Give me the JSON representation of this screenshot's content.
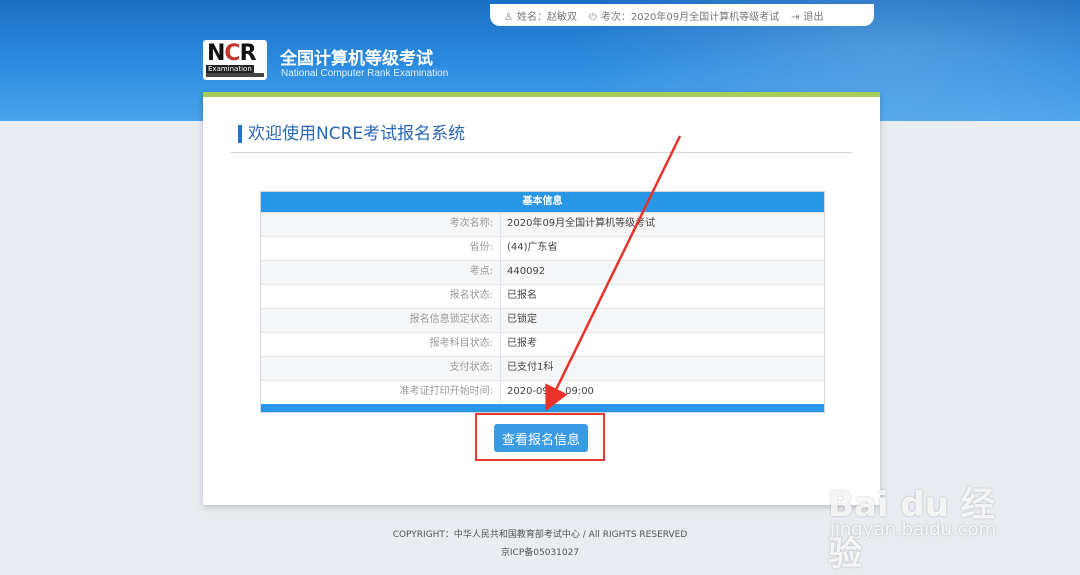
{
  "topbar": {
    "user_label": "姓名：赵敏双",
    "exam_label": "考次：2020年09月全国计算机等级考试",
    "logout_label": "退出"
  },
  "brand": {
    "logo_text_ncr": "NCR",
    "logo_text_exam": "Examination",
    "title": "全国计算机等级考试",
    "subtitle": "National Computer Rank Examination"
  },
  "main": {
    "title": "欢迎使用NCRE考试报名系统",
    "table_header": "基本信息",
    "rows": [
      {
        "label": "考次名称:",
        "value": "2020年09月全国计算机等级考试"
      },
      {
        "label": "省份:",
        "value": "(44)广东省"
      },
      {
        "label": "考点:",
        "value": "440092"
      },
      {
        "label": "报名状态:",
        "value": "已报名"
      },
      {
        "label": "报名信息锁定状态:",
        "value": "已锁定"
      },
      {
        "label": "报考科目状态:",
        "value": "已报考"
      },
      {
        "label": "支付状态:",
        "value": "已支付1科"
      },
      {
        "label": "准考证打印开始时间:",
        "value": "2020-09-... 09:00"
      }
    ],
    "button_label": "查看报名信息"
  },
  "footer": {
    "copyright": "COPYRIGHT：中华人民共和国教育部考试中心 / All RIGHTS RESERVED",
    "icp": "京ICP备05031027"
  },
  "watermark": {
    "main": "Bai du 经验",
    "sub": "jingyan.baidu.com"
  },
  "colors": {
    "header_blue": "#2d8de0",
    "accent_green": "#a6cf5a",
    "table_blue": "#2a97e6",
    "button_blue": "#3a9be4",
    "highlight_red": "#e33b2e"
  }
}
